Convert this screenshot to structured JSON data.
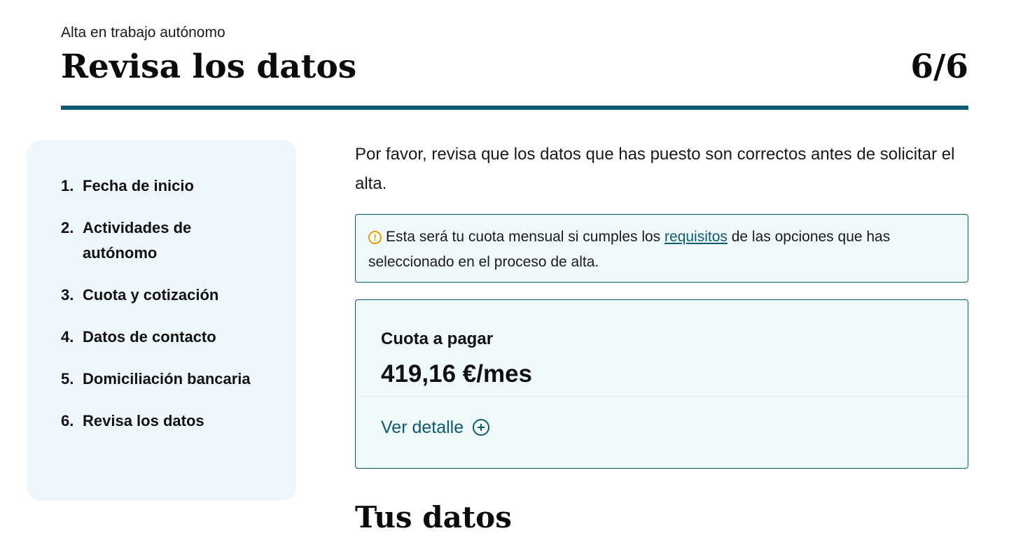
{
  "header": {
    "eyebrow": "Alta en trabajo autónomo",
    "title": "Revisa los datos",
    "step_counter": "6/6"
  },
  "sidebar": {
    "steps": [
      {
        "num": "1.",
        "label": "Fecha de inicio"
      },
      {
        "num": "2.",
        "label": "Actividades de autónomo"
      },
      {
        "num": "3.",
        "label": "Cuota y cotización"
      },
      {
        "num": "4.",
        "label": "Datos de contacto"
      },
      {
        "num": "5.",
        "label": "Domiciliación bancaria"
      },
      {
        "num": "6.",
        "label": "Revisa los datos"
      }
    ]
  },
  "main": {
    "intro": "Por favor, revisa que los datos que has puesto son correctos antes de solicitar el alta.",
    "notice": {
      "icon": "warning-icon",
      "text_before": "Esta será tu cuota mensual si cumples los ",
      "link": "requisitos",
      "text_after": " de las opciones que has seleccionado en el proceso de alta."
    },
    "quota": {
      "label": "Cuota a pagar",
      "amount": "419,16 €/mes",
      "detail_link": "Ver detalle"
    },
    "section_title": "Tus datos"
  },
  "colors": {
    "accent": "#0b5a73",
    "sidebar_bg": "#eef8fc",
    "card_bg": "#f0fafb",
    "warning": "#e0a100"
  }
}
